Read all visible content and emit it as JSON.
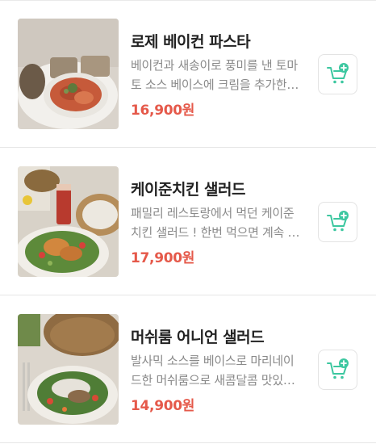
{
  "items": [
    {
      "name": "로제 베이컨 파스타",
      "description": "베이컨과 새송이로 풍미를 낸 토마토 소스 베이스에 크림을 추가한 로제 파스타",
      "price": "16,900원",
      "image": "rose-bacon-pasta-photo",
      "cart_icon": "add-to-cart-icon"
    },
    {
      "name": "케이준치킨 샐러드",
      "description": "패밀리 레스토랑에서 먹던 케이준치킨 샐러드 ! 한번 먹으면 계속 생각나는 맛",
      "price": "17,900원",
      "image": "cajun-chicken-salad-photo",
      "cart_icon": "add-to-cart-icon"
    },
    {
      "name": "머쉬룸 어니언 샐러드",
      "description": "발사믹 소스를 베이스로 마리네이드한 머쉬룸으로 새콤달콤 맛있는 샐러드",
      "price": "14,900원",
      "image": "mushroom-onion-salad-photo",
      "cart_icon": "add-to-cart-icon"
    }
  ],
  "colors": {
    "price": "#e5594a",
    "cart_icon": "#3cc7a0",
    "divider": "#e6e6e6"
  }
}
